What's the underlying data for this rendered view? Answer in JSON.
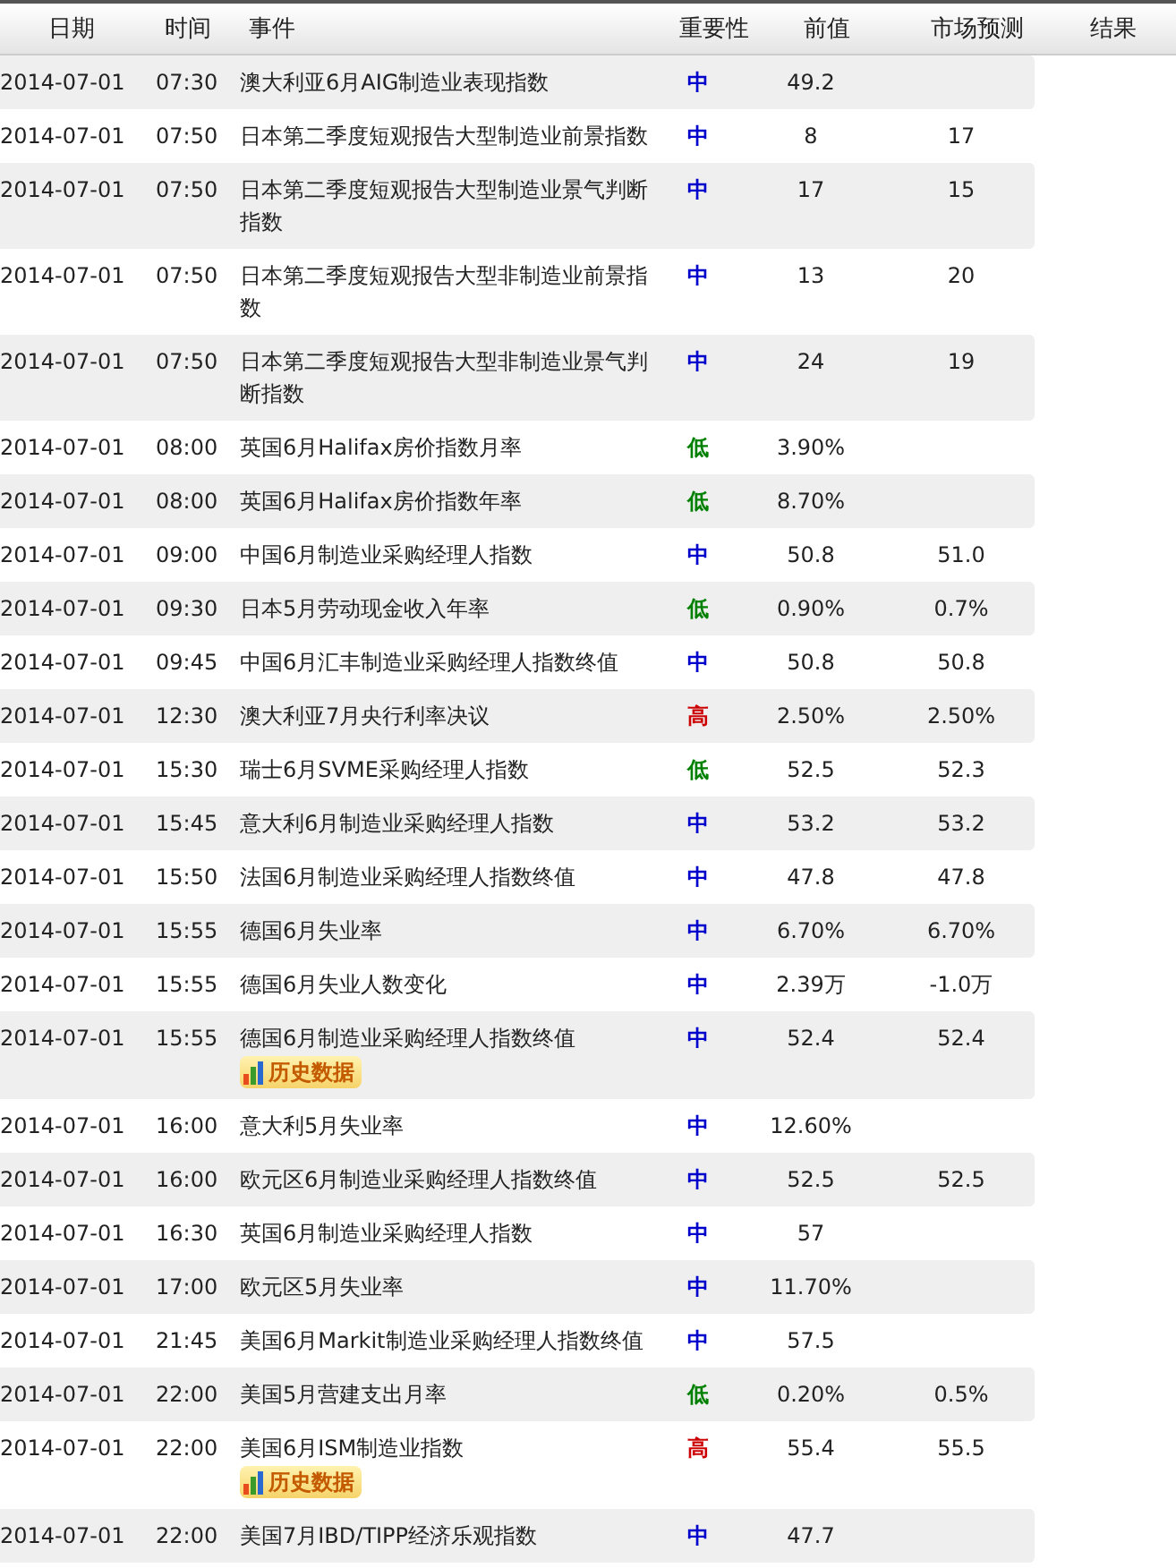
{
  "table": {
    "columns": [
      "日期",
      "时间",
      "事件",
      "重要性",
      "前值",
      "市场预测",
      "结果"
    ],
    "rows": [
      {
        "date": "2014-07-01",
        "time": "07:30",
        "event": "澳大利亚6月AIG制造业表现指数",
        "importance": {
          "text": "中",
          "color": "#0000cc"
        },
        "previous": "49.2",
        "forecast": ""
      },
      {
        "date": "2014-07-01",
        "time": "07:50",
        "event": "日本第二季度短观报告大型制造业前景指数",
        "importance": {
          "text": "中",
          "color": "#0000cc"
        },
        "previous": "8",
        "forecast": "17"
      },
      {
        "date": "2014-07-01",
        "time": "07:50",
        "event": "日本第二季度短观报告大型制造业景气判断指数",
        "importance": {
          "text": "中",
          "color": "#0000cc"
        },
        "previous": "17",
        "forecast": "15"
      },
      {
        "date": "2014-07-01",
        "time": "07:50",
        "event": "日本第二季度短观报告大型非制造业前景指数",
        "importance": {
          "text": "中",
          "color": "#0000cc"
        },
        "previous": "13",
        "forecast": "20"
      },
      {
        "date": "2014-07-01",
        "time": "07:50",
        "event": "日本第二季度短观报告大型非制造业景气判断指数",
        "importance": {
          "text": "中",
          "color": "#0000cc"
        },
        "previous": "24",
        "forecast": "19"
      },
      {
        "date": "2014-07-01",
        "time": "08:00",
        "event": "英国6月Halifax房价指数月率",
        "importance": {
          "text": "低",
          "color": "#008000"
        },
        "previous": "3.90%",
        "forecast": ""
      },
      {
        "date": "2014-07-01",
        "time": "08:00",
        "event": "英国6月Halifax房价指数年率",
        "importance": {
          "text": "低",
          "color": "#008000"
        },
        "previous": "8.70%",
        "forecast": ""
      },
      {
        "date": "2014-07-01",
        "time": "09:00",
        "event": "中国6月制造业采购经理人指数",
        "importance": {
          "text": "中",
          "color": "#0000cc"
        },
        "previous": "50.8",
        "forecast": "51.0"
      },
      {
        "date": "2014-07-01",
        "time": "09:30",
        "event": "日本5月劳动现金收入年率",
        "importance": {
          "text": "低",
          "color": "#008000"
        },
        "previous": "0.90%",
        "forecast": "0.7%"
      },
      {
        "date": "2014-07-01",
        "time": "09:45",
        "event": "中国6月汇丰制造业采购经理人指数终值",
        "importance": {
          "text": "中",
          "color": "#0000cc"
        },
        "previous": "50.8",
        "forecast": "50.8"
      },
      {
        "date": "2014-07-01",
        "time": "12:30",
        "event": "澳大利亚7月央行利率决议",
        "importance": {
          "text": "高",
          "color": "#cc0000"
        },
        "previous": "2.50%",
        "forecast": "2.50%"
      },
      {
        "date": "2014-07-01",
        "time": "15:30",
        "event": "瑞士6月SVME采购经理人指数",
        "importance": {
          "text": "低",
          "color": "#008000"
        },
        "previous": "52.5",
        "forecast": "52.3"
      },
      {
        "date": "2014-07-01",
        "time": "15:45",
        "event": "意大利6月制造业采购经理人指数",
        "importance": {
          "text": "中",
          "color": "#0000cc"
        },
        "previous": "53.2",
        "forecast": "53.2"
      },
      {
        "date": "2014-07-01",
        "time": "15:50",
        "event": "法国6月制造业采购经理人指数终值",
        "importance": {
          "text": "中",
          "color": "#0000cc"
        },
        "previous": "47.8",
        "forecast": "47.8"
      },
      {
        "date": "2014-07-01",
        "time": "15:55",
        "event": "德国6月失业率",
        "importance": {
          "text": "中",
          "color": "#0000cc"
        },
        "previous": "6.70%",
        "forecast": "6.70%"
      },
      {
        "date": "2014-07-01",
        "time": "15:55",
        "event": "德国6月失业人数变化",
        "importance": {
          "text": "中",
          "color": "#0000cc"
        },
        "previous": "2.39万",
        "forecast": "-1.0万"
      },
      {
        "date": "2014-07-01",
        "time": "15:55",
        "event": "德国6月制造业采购经理人指数终值",
        "importance": {
          "text": "中",
          "color": "#0000cc"
        },
        "previous": "52.4",
        "forecast": "52.4",
        "history_button": "历史数据"
      },
      {
        "date": "2014-07-01",
        "time": "16:00",
        "event": "意大利5月失业率",
        "importance": {
          "text": "中",
          "color": "#0000cc"
        },
        "previous": "12.60%",
        "forecast": ""
      },
      {
        "date": "2014-07-01",
        "time": "16:00",
        "event": "欧元区6月制造业采购经理人指数终值",
        "importance": {
          "text": "中",
          "color": "#0000cc"
        },
        "previous": "52.5",
        "forecast": "52.5"
      },
      {
        "date": "2014-07-01",
        "time": "16:30",
        "event": "英国6月制造业采购经理人指数",
        "importance": {
          "text": "中",
          "color": "#0000cc"
        },
        "previous": "57",
        "forecast": ""
      },
      {
        "date": "2014-07-01",
        "time": "17:00",
        "event": "欧元区5月失业率",
        "importance": {
          "text": "中",
          "color": "#0000cc"
        },
        "previous": "11.70%",
        "forecast": ""
      },
      {
        "date": "2014-07-01",
        "time": "21:45",
        "event": "美国6月Markit制造业采购经理人指数终值",
        "importance": {
          "text": "中",
          "color": "#0000cc"
        },
        "previous": "57.5",
        "forecast": ""
      },
      {
        "date": "2014-07-01",
        "time": "22:00",
        "event": "美国5月营建支出月率",
        "importance": {
          "text": "低",
          "color": "#008000"
        },
        "previous": "0.20%",
        "forecast": "0.5%"
      },
      {
        "date": "2014-07-01",
        "time": "22:00",
        "event": "美国6月ISM制造业指数",
        "importance": {
          "text": "高",
          "color": "#cc0000"
        },
        "previous": "55.4",
        "forecast": "55.5",
        "history_button": "历史数据"
      },
      {
        "date": "2014-07-01",
        "time": "22:00",
        "event": "美国7月IBD/TIPP经济乐观指数",
        "importance": {
          "text": "中",
          "color": "#0000cc"
        },
        "previous": "47.7",
        "forecast": ""
      }
    ]
  }
}
